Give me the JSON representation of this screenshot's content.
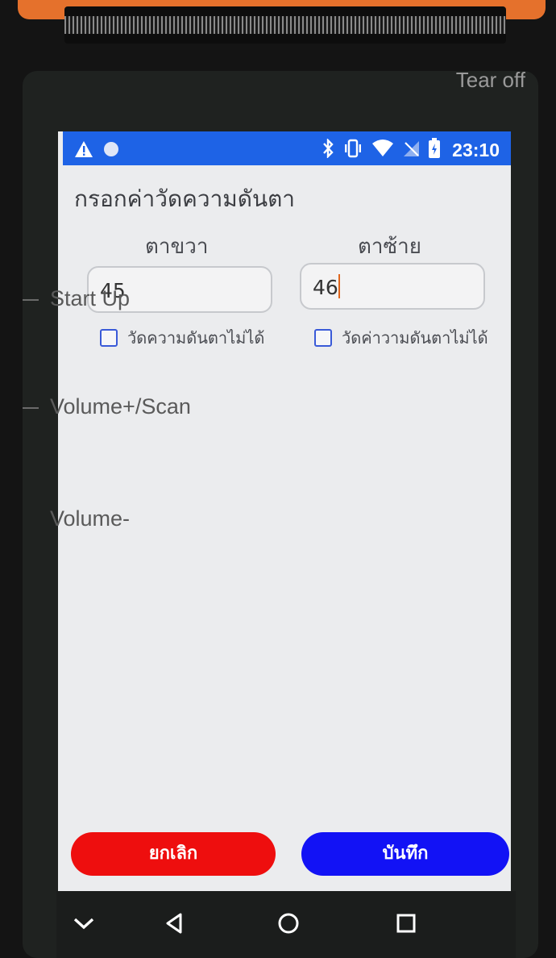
{
  "hardware": {
    "tear_off_label": "Tear off",
    "side_buttons": [
      "Start Up",
      "Volume+/Scan",
      "Volume-"
    ]
  },
  "status_bar": {
    "left_icons": [
      "warning-icon",
      "circle-notification-icon"
    ],
    "right_icons": [
      "bluetooth-icon",
      "vibrate-icon",
      "wifi-icon",
      "no-signal-icon",
      "battery-icon"
    ],
    "time": "23:10",
    "color": "#1e63e6"
  },
  "form": {
    "title": "กรอกค่าวัดความดันตา",
    "right_eye": {
      "label": "ตาขวา",
      "value": "45",
      "unable_label": "วัดความดันตาไม่ได้",
      "unable_checked": false
    },
    "left_eye": {
      "label": "ตาซ้าย",
      "value": "46",
      "unable_label": "วัดค่าวามดันตาไม่ได้",
      "unable_checked": false
    }
  },
  "actions": {
    "cancel_label": "ยกเลิก",
    "cancel_color": "#ee0e0e",
    "save_label": "บันทึก",
    "save_color": "#1212f5"
  },
  "navigation": {
    "icons": [
      "collapse-chevron-icon",
      "back-icon",
      "home-icon",
      "recents-icon"
    ]
  }
}
